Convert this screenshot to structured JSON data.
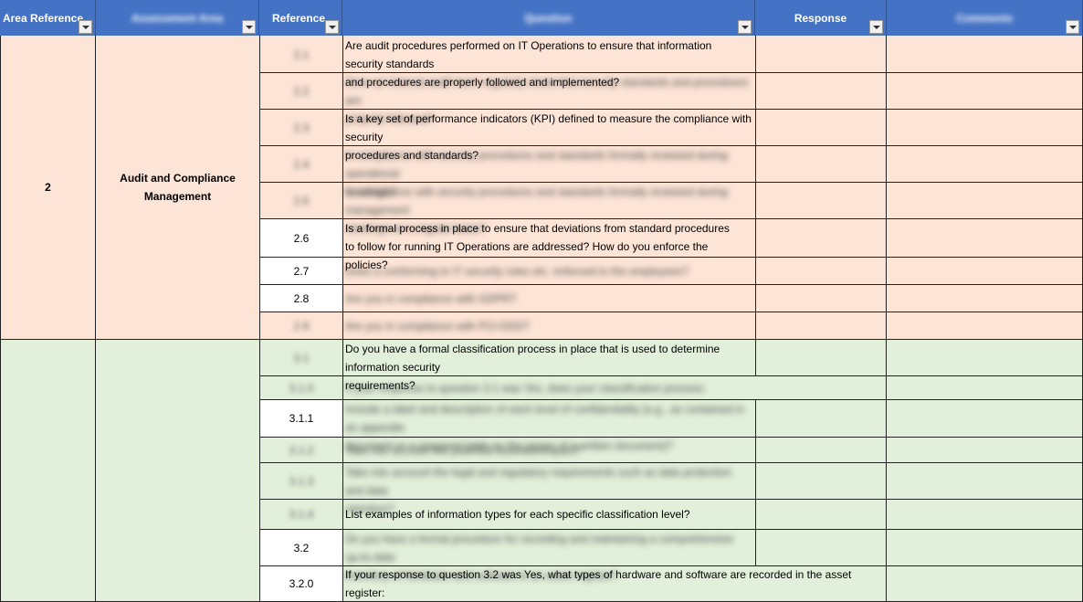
{
  "headers": {
    "area_reference": "Area Reference",
    "assessment_area": "Assessment Area",
    "reference": "Reference",
    "question": "Question",
    "response": "Response",
    "comments": "Comments"
  },
  "area_row": {
    "area_ref": "2",
    "area_name_line1": "Audit and Compliance",
    "area_name_line2": "Management"
  },
  "rows": [
    {
      "ref": "2.1",
      "q1": "Are audit procedures performed on IT Operations to ensure that information security standards",
      "q2": "and procedures are properly followed and implemented?"
    },
    {
      "ref": "2.2",
      "q1": "Does an internal audit team regularly check that security standards and procedures are",
      "q2": "properly followed?"
    },
    {
      "ref": "2.3",
      "q1": "Is a key set of performance indicators (KPI) defined to measure the compliance with security",
      "q2": "procedures and standards?"
    },
    {
      "ref": "2.4",
      "q1": "Is compliance with security procedures and standards formally reviewed during operational",
      "q2": "meetings?"
    },
    {
      "ref": "2.5",
      "q1": "Is compliance with security procedures and standards formally reviewed during management",
      "q2": "meetings on a regular basis?"
    },
    {
      "ref": "2.6",
      "q1": "Is a formal process in place to ensure that deviations from standard procedures",
      "q2": "to follow for running IT Operations are addressed? How do you enforce the policies?"
    },
    {
      "ref": "2.7",
      "q1": "Does a conforming to IT security rules etc. enforced to the employees?"
    },
    {
      "ref": "2.8",
      "q1": "Are you in compliance with GDPR?"
    },
    {
      "ref": "2.9",
      "q1": "Are you in compliance with PCI-DSS?"
    },
    {
      "ref": "3.1",
      "q1": "Do you have a formal classification process in place that is used to determine information security",
      "q2": "requirements?"
    },
    {
      "ref": "3.1.0",
      "q1": "If your response to question 3.1 was Yes, does your classification process:"
    },
    {
      "ref": "3.1.1",
      "q1": "Include a label and description of each level of confidentiality (e.g., as contained in an appendix",
      "q2": "document or a prepared table on the pages of a written document)?"
    },
    {
      "ref": "3.1.2",
      "q1": "Take into account the potential business impact?"
    },
    {
      "ref": "3.1.3",
      "q1": "Take into account the legal and regulatory requirements such as data protection and data",
      "q2": "retention?"
    },
    {
      "ref": "3.1.4",
      "q1": "List examples of information types for each specific classification level?"
    },
    {
      "ref": "3.2",
      "q1": "Do you have a formal procedure for recording and maintaining a comprehensive up-to-date",
      "q2": "inventory of hardware and software in an asset register?"
    },
    {
      "ref": "3.2.0",
      "q1": "If your response to question 3.2 was Yes, what types of hardware and software are recorded in the asset register:"
    }
  ]
}
